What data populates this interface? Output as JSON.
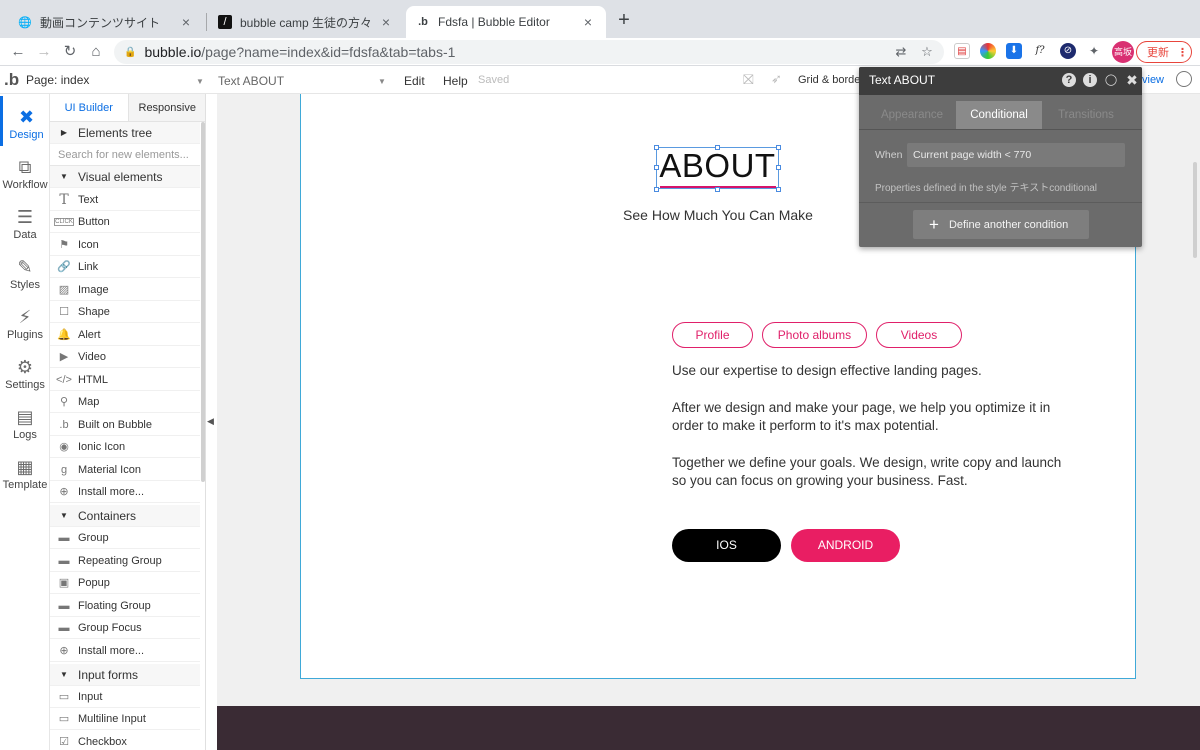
{
  "browser": {
    "tabs": [
      {
        "title": "動画コンテンツサイト",
        "favicon": "globe-icon"
      },
      {
        "title": "bubble camp 生徒の方々からいた",
        "favicon": "slash-icon"
      },
      {
        "title": "Fdsfa | Bubble Editor",
        "favicon": "bubble-icon"
      }
    ],
    "url_host": "bubble.io",
    "url_path": "/page?name=index&id=fdsfa&tab=tabs-1",
    "profile_initials": "高坂",
    "update_label": "更新",
    "menu_dots": "⋮"
  },
  "editor": {
    "logo": ".b",
    "page_label": "Page: index",
    "element_label": "Text ABOUT",
    "menu": [
      "Edit",
      "Help"
    ],
    "saved_status": "Saved",
    "grid_label": "Grid & borde",
    "preview_label": "view"
  },
  "rail": [
    {
      "label": "Design",
      "icon": "design-icon"
    },
    {
      "label": "Workflow",
      "icon": "workflow-icon"
    },
    {
      "label": "Data",
      "icon": "database-icon"
    },
    {
      "label": "Styles",
      "icon": "brush-icon"
    },
    {
      "label": "Plugins",
      "icon": "plug-icon"
    },
    {
      "label": "Settings",
      "icon": "gear-icon"
    },
    {
      "label": "Logs",
      "icon": "document-icon"
    },
    {
      "label": "Template",
      "icon": "template-icon"
    }
  ],
  "palette": {
    "tabs": [
      "UI Builder",
      "Responsive"
    ],
    "elements_tree": "Elements tree",
    "search_placeholder": "Search for new elements...",
    "sections": {
      "visual": "Visual elements",
      "containers": "Containers",
      "inputs": "Input forms"
    },
    "visual_items": [
      "Text",
      "Button",
      "Icon",
      "Link",
      "Image",
      "Shape",
      "Alert",
      "Video",
      "HTML",
      "Map",
      "Built on Bubble",
      "Ionic Icon",
      "Material Icon",
      "Install more..."
    ],
    "container_items": [
      "Group",
      "Repeating Group",
      "Popup",
      "Floating Group",
      "Group Focus",
      "Install more..."
    ],
    "input_items": [
      "Input",
      "Multiline Input",
      "Checkbox"
    ]
  },
  "canvas": {
    "heading": "ABOUT",
    "subtitle": "See How Much You Can Make",
    "pills": [
      "Profile",
      "Photo albums",
      "Videos"
    ],
    "paragraphs": [
      "Use our expertise to design effective landing pages.",
      "After we design and make your page, we help you optimize it in order to make it perform to it's max potential.",
      "Together we define your goals. We design, write copy and launch so you can focus on growing your business. Fast."
    ],
    "buttons": [
      "IOS",
      "ANDROID"
    ]
  },
  "property_editor": {
    "title": "Text ABOUT",
    "tabs": [
      "Appearance",
      "Conditional",
      "Transitions"
    ],
    "active_tab": "Conditional",
    "when_label": "When",
    "when_value": "Current page width < 770",
    "style_note": "Properties defined in the style テキストconditional",
    "define_label": "Define another condition"
  },
  "colors": {
    "accent": "#0b6ee3",
    "pink": "#e91e63",
    "selection": "#4a8be0"
  }
}
